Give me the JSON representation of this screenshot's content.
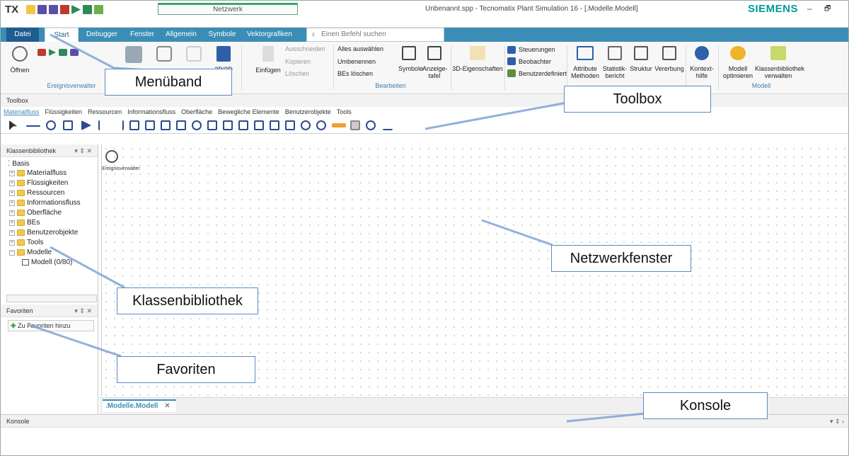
{
  "titlebar": {
    "app_logo": "TX",
    "context_tab": "Netzwerk",
    "doc_title": "Unbenannt.spp - Tecnomatix Plant Simulation 16 - [.Modelle.Modell]",
    "brand": "SIEMENS",
    "brand_color": "#009999",
    "minimize": "–",
    "restore": "🗗"
  },
  "ribbon_tabs": [
    "Datei",
    "Start",
    "Debugger",
    "Fenster",
    "Allgemein",
    "Symbole",
    "Vektorgrafiken"
  ],
  "search": {
    "placeholder": "Einen Befehl suchen"
  },
  "ribbon": {
    "open_label": "Öffnen",
    "group_ereignis": "Ereignisverwalter",
    "open2d3d": "2D/3D öffnen",
    "einfuegen": "Einfügen",
    "ausschneiden": "Ausschneiden",
    "kopieren": "Kopieren",
    "loeschen": "Löschen",
    "alles_auswaehlen": "Alles auswählen",
    "umbenennen": "Umbenennen",
    "bes_loeschen": "BEs löschen",
    "symbole": "Symbole",
    "anzeigetafel": "Anzeige-tafel",
    "group_bearbeiten": "Bearbeiten",
    "eigenschaften3d": "3D-Eigenschaften",
    "steuerungen": "Steuerungen",
    "beobachter": "Beobachter",
    "benutzerdefiniert": "Benutzerdefiniert",
    "attribute": "Attribute Methoden",
    "statistik": "Statistik-bericht",
    "struktur": "Struktur",
    "vererbung": "Vererbung",
    "kontexthilfe": "Kontext-hilfe",
    "modell_opt": "Modell optimieren",
    "klassenbib_verw": "Klassenbibliothek verwalten",
    "group_modell": "Modell"
  },
  "toolbox": {
    "header": "Toolbox",
    "tabs": [
      "Materialfluss",
      "Flüssigkeiten",
      "Ressourcen",
      "Informationsfluss",
      "Oberfläche",
      "Bewegliche Elemente",
      "Benutzerobjekte",
      "Tools"
    ]
  },
  "class_library": {
    "header": "Klassenbibliothek",
    "controls": "▾ ⇕ ✕",
    "root": "Basis",
    "items": [
      "Materialfluss",
      "Flüssigkeiten",
      "Ressourcen",
      "Informationsfluss",
      "Oberfläche",
      "BEs",
      "Benutzerobjekte",
      "Tools",
      "Modelle"
    ],
    "model_item": "Modell (0/80)"
  },
  "favorites": {
    "header": "Favoriten",
    "controls": "▾ ⇕ ✕",
    "add_button": "Zu Favoriten hinzu"
  },
  "network": {
    "event_label": "Ereignisverwalter",
    "tab_label": ".Modelle.Modell",
    "tab_close": "✕"
  },
  "console": {
    "header": "Konsole",
    "controls": "▾ ⇕ ›"
  },
  "callouts": {
    "menueband": "Menüband",
    "toolbox": "Toolbox",
    "netzwerkfenster": "Netzwerkfenster",
    "klassenbibliothek": "Klassenbibliothek",
    "favoriten": "Favoriten",
    "konsole": "Konsole"
  }
}
